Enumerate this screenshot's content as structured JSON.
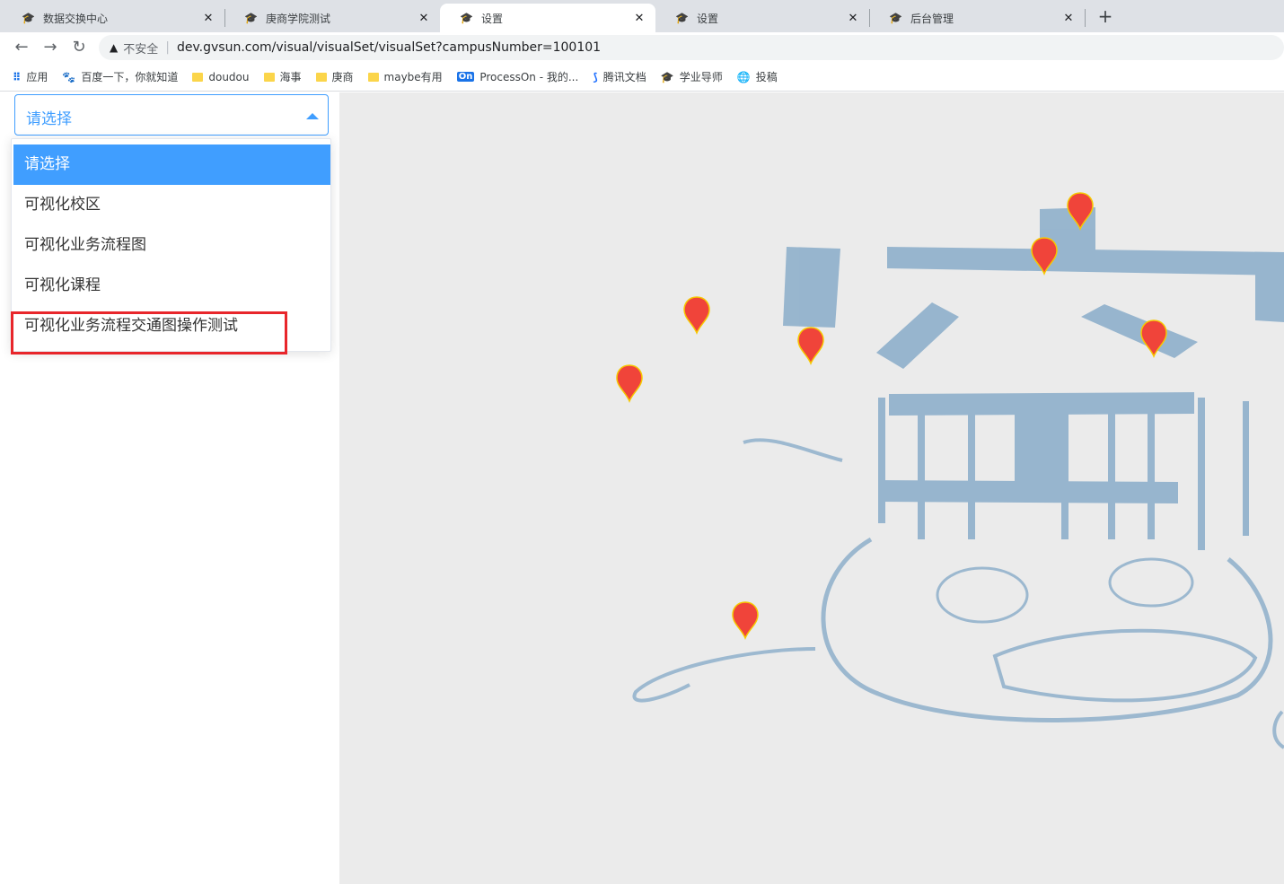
{
  "tabs": [
    {
      "title": "数据交换中心",
      "active": false
    },
    {
      "title": "庚商学院测试",
      "active": false
    },
    {
      "title": "设置",
      "active": true
    },
    {
      "title": "设置",
      "active": false
    },
    {
      "title": "后台管理",
      "active": false
    }
  ],
  "tab_icon": "graduation-cap-icon",
  "address": {
    "security_label": "不安全",
    "url": "dev.gvsun.com/visual/visualSet/visualSet?campusNumber=100101"
  },
  "bookmarks": [
    {
      "label": "应用",
      "icon": "apps-icon"
    },
    {
      "label": "百度一下，你就知道",
      "icon": "baidu-icon"
    },
    {
      "label": "doudou",
      "icon": "folder-icon"
    },
    {
      "label": "海事",
      "icon": "folder-icon"
    },
    {
      "label": "庚商",
      "icon": "folder-icon"
    },
    {
      "label": "maybe有用",
      "icon": "folder-icon"
    },
    {
      "label": "ProcessOn - 我的...",
      "icon": "processon-icon"
    },
    {
      "label": "腾讯文档",
      "icon": "tencent-docs-icon"
    },
    {
      "label": "学业导师",
      "icon": "graduation-cap-icon"
    },
    {
      "label": "投稿",
      "icon": "globe-icon"
    }
  ],
  "select": {
    "value": "请选择",
    "options": [
      "请选择",
      "可视化校区",
      "可视化业务流程图",
      "可视化课程",
      "可视化业务流程交通图操作测试"
    ],
    "selected_index": 0
  },
  "colors": {
    "accent": "#409eff",
    "highlight_box": "#e8262b",
    "map_bg": "#ebebeb",
    "map_shape": "#8fb0cb",
    "marker": "#f0443a"
  }
}
